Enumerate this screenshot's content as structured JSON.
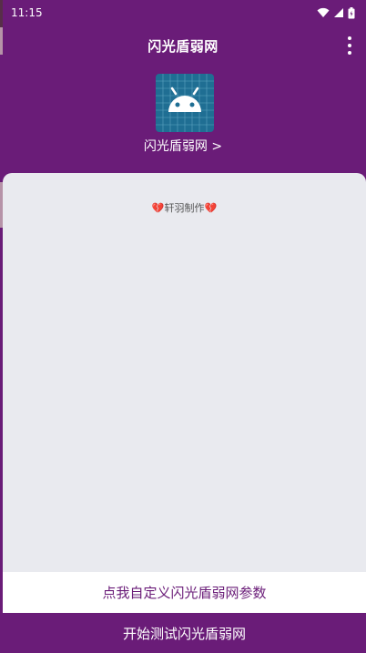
{
  "status_bar": {
    "time": "11:15",
    "icons": [
      "wifi-icon",
      "signal-icon",
      "battery-icon"
    ]
  },
  "toolbar": {
    "title": "闪光盾弱网",
    "menu_icon": "more-vert-icon"
  },
  "app": {
    "icon": "android-icon",
    "name": "闪光盾弱网 >"
  },
  "card": {
    "credit": "💔轩羽制作💔"
  },
  "buttons": {
    "custom_label": "点我自定义闪光盾弱网参数",
    "start_label": "开始测试闪光盾弱网"
  },
  "colors": {
    "primary": "#6a1c78",
    "card_bg": "#e9eaef",
    "icon_bg": "#1f6e93"
  }
}
